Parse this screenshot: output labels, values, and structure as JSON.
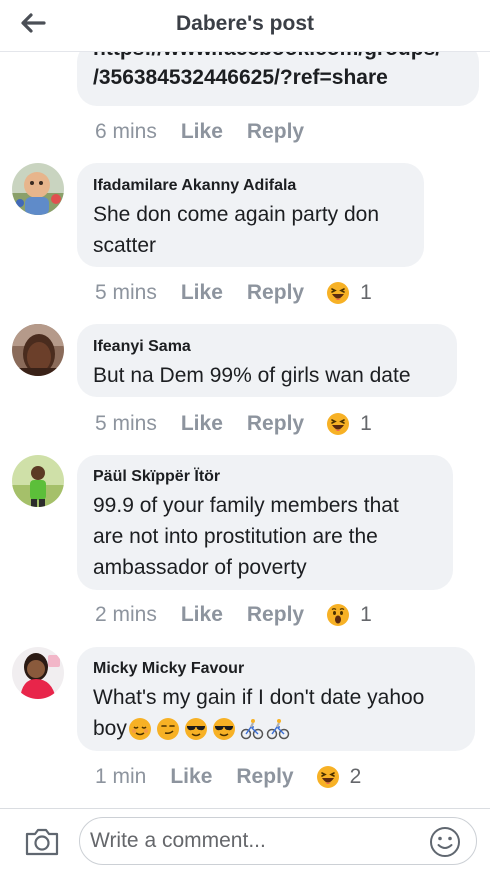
{
  "header": {
    "title": "Dabere's post"
  },
  "first_comment": {
    "link_line1": "https://www.facebook.com/groups/",
    "link_line2": "/356384532446625/?ref=share",
    "time": "6 mins",
    "like": "Like",
    "reply": "Reply"
  },
  "comments": [
    {
      "author": "Ifadamilare Akanny Adifala",
      "line1": "She don come again party don",
      "line2": "scatter",
      "time": "5 mins",
      "like": "Like",
      "reply": "Reply",
      "reaction": "haha",
      "count": "1"
    },
    {
      "author": "Ifeanyi Sama",
      "line1": "But na Dem 99% of girls wan date",
      "time": "5 mins",
      "like": "Like",
      "reply": "Reply",
      "reaction": "haha",
      "count": "1"
    },
    {
      "author": "Päül Skïppër Ïtör",
      "line1": "99.9 of your family members that",
      "line2": "are not into prostitution are the",
      "line3": "ambassador of poverty",
      "time": "2 mins",
      "like": "Like",
      "reply": "Reply",
      "reaction": "wow",
      "count": "1"
    },
    {
      "author": "Micky Micky Favour",
      "line1": "What's my gain if I don't date yahoo",
      "line2": "boy",
      "line2_emojis": [
        "relieved-face",
        "smirking-face",
        "sunglasses-face",
        "sunglasses-face",
        "person-biking",
        "person-biking"
      ],
      "time": "1 min",
      "like": "Like",
      "reply": "Reply",
      "reaction": "haha",
      "count": "2"
    }
  ],
  "composer": {
    "placeholder": "Write a comment..."
  },
  "colors": {
    "bubble": "#f0f2f5",
    "meta": "#8d949e",
    "emoji_yellow": "#f7b125"
  }
}
